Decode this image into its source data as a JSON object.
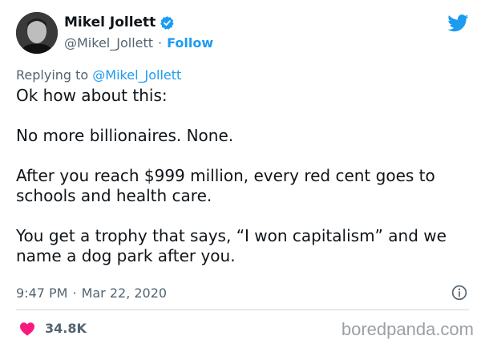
{
  "author": {
    "name": "Mikel Jollett",
    "handle": "@Mikel_Jollett",
    "separator": "·",
    "follow_label": "Follow"
  },
  "reply": {
    "prefix": "Replying to",
    "mention": "@Mikel_Jollett"
  },
  "tweet": {
    "paragraphs": [
      "Ok how about this:",
      "No more billionaires. None.",
      "After you reach $999 million, every red cent goes to schools and health care.",
      "You get a trophy that says, “I won capitalism” and we name a dog park after you."
    ]
  },
  "meta": {
    "time": "9:47 PM",
    "separator": "·",
    "date": "Mar 22, 2020"
  },
  "engagement": {
    "likes": "34.8K"
  },
  "watermark": "boredpanda.com",
  "colors": {
    "accent": "#1d9bf0",
    "like": "#f91880",
    "secondary_text": "#536471"
  },
  "icons": [
    "verified-badge-icon",
    "twitter-bird-icon",
    "info-icon",
    "heart-icon"
  ]
}
